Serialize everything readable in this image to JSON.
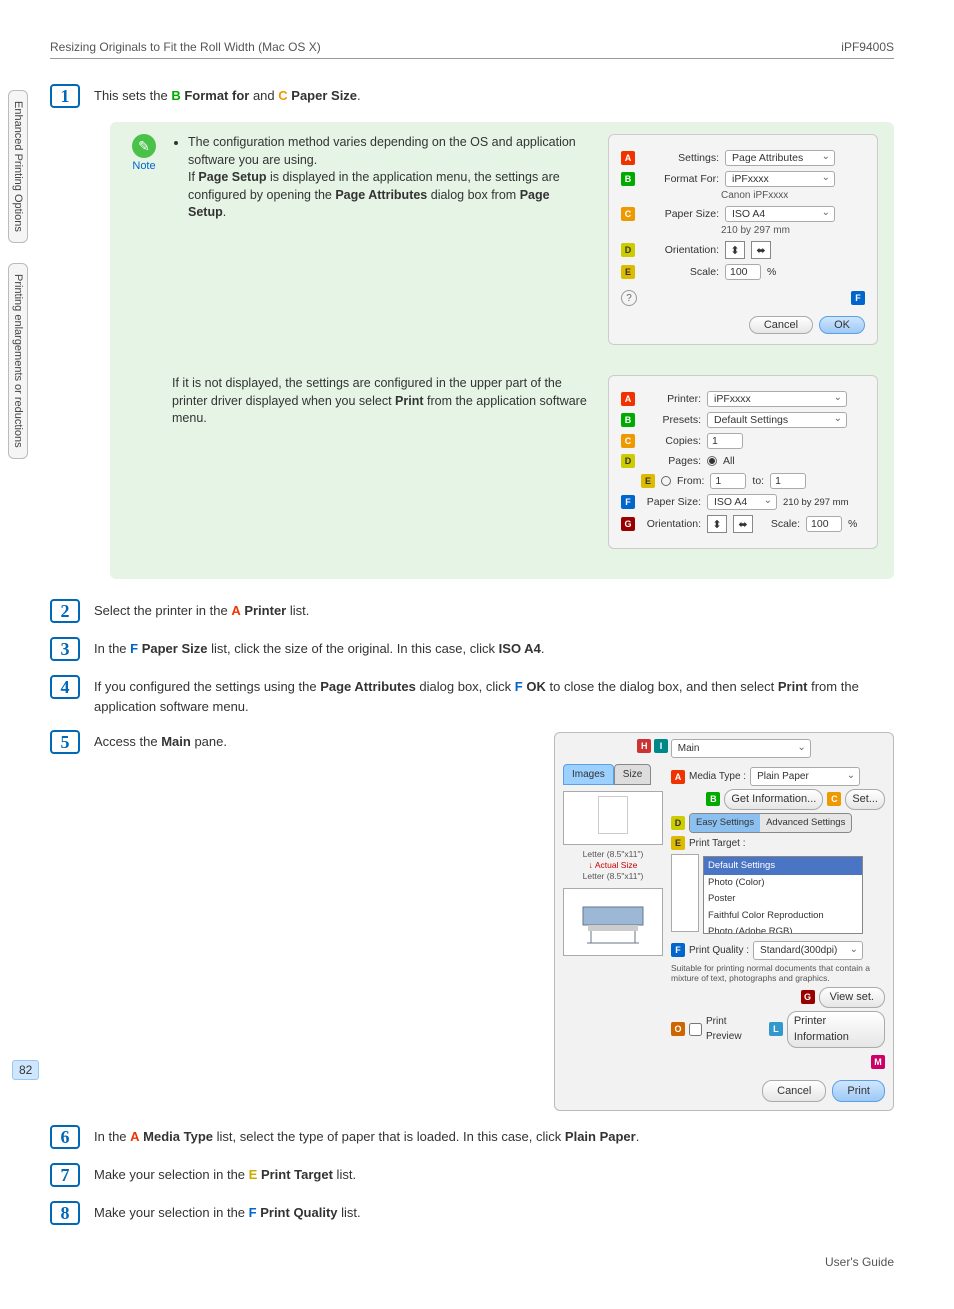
{
  "header": {
    "left": "Resizing Originals to Fit the Roll Width (Mac OS X)",
    "right": "iPF9400S"
  },
  "sidebar": {
    "tab1": "Enhanced Printing Options",
    "tab2": "Printing enlargements or reductions"
  },
  "steps": {
    "s1": {
      "num": "1",
      "pre": "This sets the ",
      "b": "B",
      "b_text": "Format for",
      "mid1": " and ",
      "c": "C",
      "c_text": "Paper Size",
      "post": "."
    },
    "note": {
      "label": "Note",
      "bullet_pre": "The configuration method varies depending on the OS and application software you are using.",
      "line2a": "If ",
      "line2b": "Page Setup",
      "line2c": " is displayed in the application menu, the settings are configured by opening the ",
      "line2d": "Page Attributes",
      "line2e": " dialog box from ",
      "line2f": "Page Setup",
      "line2g": ".",
      "second_para": "If it is not displayed, the settings are configured in the upper part of the printer driver displayed when you select ",
      "second_bold": "Print",
      "second_post": " from the application software menu."
    },
    "s2": {
      "num": "2",
      "pre": "Select the printer in the ",
      "a": "A",
      "a_text": "Printer",
      "post": " list."
    },
    "s3": {
      "num": "3",
      "pre": "In the ",
      "f": "F",
      "f_text": "Paper Size",
      "mid": " list, click the size of the original. In this case, click ",
      "bold": "ISO A4",
      "post": "."
    },
    "s4": {
      "num": "4",
      "pre": "If you configured the settings using the ",
      "bold1": "Page Attributes",
      "mid1": " dialog box, click ",
      "f": "F",
      "f_text": "OK",
      "mid2": " to close the dialog box, and then select ",
      "bold2": "Print",
      "post": " from the application software menu."
    },
    "s5": {
      "num": "5",
      "pre": "Access the ",
      "bold": "Main",
      "post": " pane."
    },
    "s6": {
      "num": "6",
      "pre": "In the ",
      "a": "A",
      "a_text": "Media Type",
      "mid": " list, select the type of paper that is loaded. In this case, click ",
      "bold": "Plain Paper",
      "post": "."
    },
    "s7": {
      "num": "7",
      "pre": "Make your selection in the ",
      "e": "E",
      "e_text": "Print Target",
      "post": " list."
    },
    "s8": {
      "num": "8",
      "pre": "Make your selection in the ",
      "f": "F",
      "f_text": "Print Quality",
      "post": " list."
    }
  },
  "dlg1": {
    "settings_l": "Settings:",
    "settings_v": "Page Attributes",
    "format_l": "Format For:",
    "format_v": "iPFxxxx",
    "format_sub": "Canon iPFxxxx",
    "paper_l": "Paper Size:",
    "paper_v": "ISO A4",
    "paper_sub": "210 by 297 mm",
    "orient_l": "Orientation:",
    "scale_l": "Scale:",
    "scale_v": "100",
    "scale_unit": "%",
    "cancel": "Cancel",
    "ok": "OK"
  },
  "dlg2": {
    "printer_l": "Printer:",
    "printer_v": "iPFxxxx",
    "presets_l": "Presets:",
    "presets_v": "Default Settings",
    "copies_l": "Copies:",
    "copies_v": "1",
    "pages_l": "Pages:",
    "all": "All",
    "from_l": "From:",
    "from_v": "1",
    "to_l": "to:",
    "to_v": "1",
    "paper_l": "Paper Size:",
    "paper_v": "ISO A4",
    "paper_dim": "210 by 297 mm",
    "orient_l": "Orientation:",
    "scale_l": "Scale:",
    "scale_v": "100",
    "scale_unit": "%"
  },
  "mainpane": {
    "top": "Main",
    "tab_images": "Images",
    "tab_size": "Size",
    "media_l": "Media Type :",
    "media_v": "Plain Paper",
    "getinfo": "Get Information...",
    "set": "Set...",
    "easy": "Easy Settings",
    "advanced": "Advanced Settings",
    "target_l": "Print Target :",
    "list_hdr": "Default Settings",
    "list_i1": "Photo (Color)",
    "list_i2": "Poster",
    "list_i3": "Faithful Color Reproduction",
    "list_i4": "Photo (Adobe RGB)",
    "quality_l": "Print Quality :",
    "quality_v": "Standard(300dpi)",
    "qnote": "Suitable for printing normal documents that contain a mixture of text, photographs and graphics.",
    "viewset": "View set.",
    "preview_l": "Print Preview",
    "printerinfo": "Printer Information",
    "sizes_1": "Letter (8.5\"x11\")",
    "sizes_2": "Actual Size",
    "sizes_3": "Letter (8.5\"x11\")",
    "cancel": "Cancel",
    "print": "Print"
  },
  "pagenum": "82",
  "footer": "User's Guide"
}
